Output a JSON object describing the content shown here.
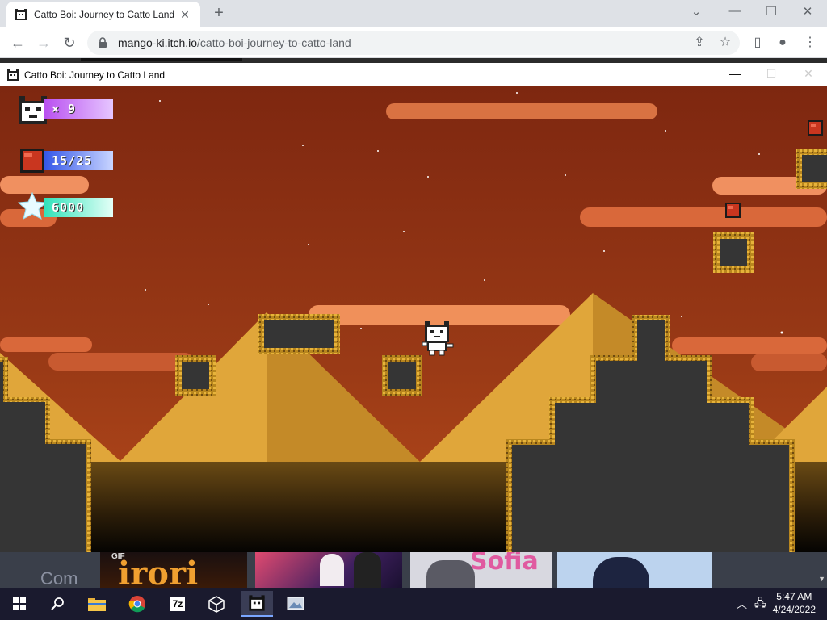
{
  "browser": {
    "tab_title": "Catto Boi: Journey to Catto Land",
    "tab_close": "✕",
    "new_tab": "+",
    "url_host": "mango-ki.itch.io",
    "url_path": "/catto-boi-journey-to-catto-land"
  },
  "game_window": {
    "title": "Catto Boi: Journey to Catto Land"
  },
  "hud": {
    "lives": "× 9",
    "gems": "15/25",
    "score": "6000"
  },
  "thumbnails": {
    "left_text": "Com",
    "gif_badge": "GIF",
    "game1": "irori",
    "game3": "Sofia"
  },
  "taskbar": {
    "time": "5:47 AM",
    "date": "4/24/2022",
    "app_7z": "7z"
  },
  "colors": {
    "sky": "#8a2e14",
    "pyramid_light": "#e0a63a",
    "pyramid_dark": "#b67d22",
    "rock": "#353535",
    "gold_trim": "#c99a2a"
  }
}
